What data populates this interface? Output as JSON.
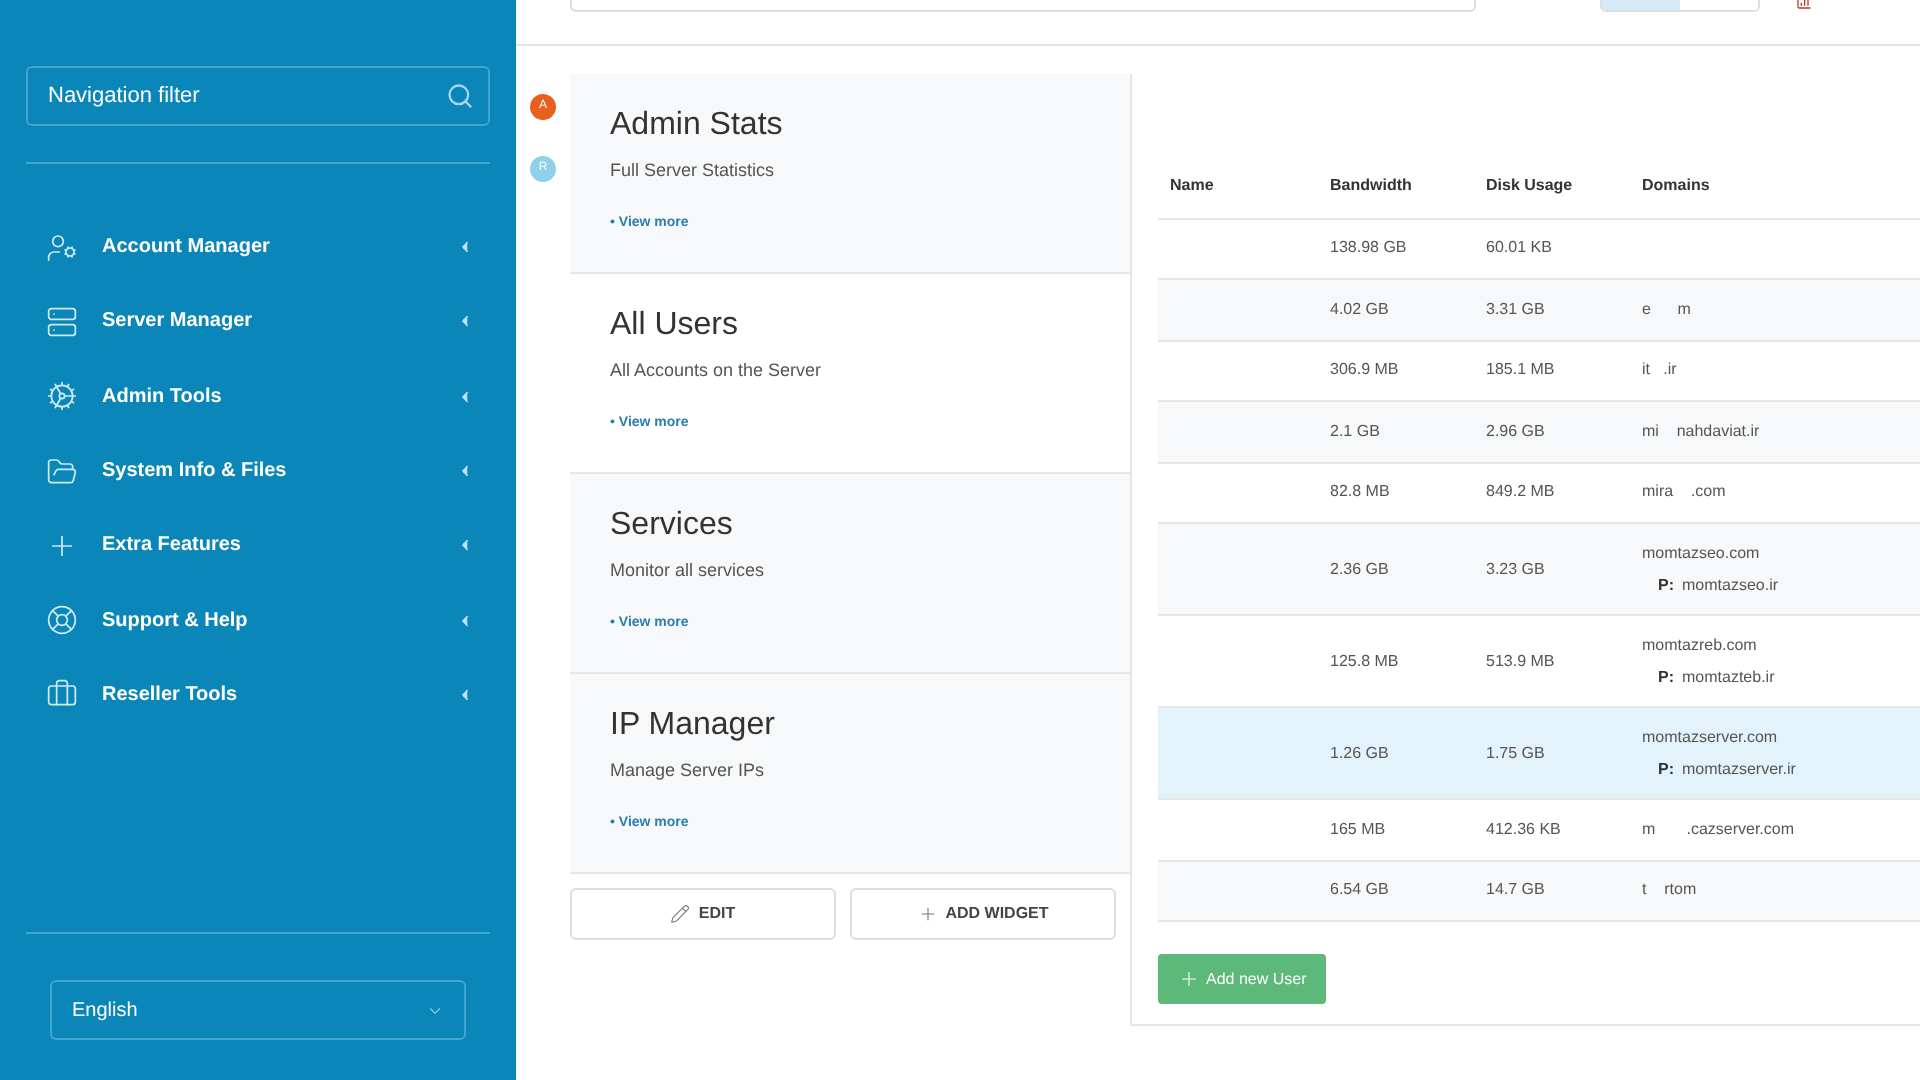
{
  "sidebar": {
    "filter": {
      "placeholder": "Navigation filter"
    },
    "items": [
      {
        "label": "Account Manager"
      },
      {
        "label": "Server Manager"
      },
      {
        "label": "Admin Tools"
      },
      {
        "label": "System Info & Files"
      },
      {
        "label": "Extra Features"
      },
      {
        "label": "Support & Help"
      },
      {
        "label": "Reseller Tools"
      }
    ],
    "language": "English"
  },
  "top_toggle": [
    {
      "selected": true
    },
    {
      "selected": false
    }
  ],
  "badges": [
    {
      "label": "A",
      "color": "#e8601c"
    },
    {
      "label": "R",
      "color": "#8fd0ea"
    }
  ],
  "widgets": [
    {
      "title": "Admin Stats",
      "subtitle": "Full Server Statistics",
      "link": "• View more"
    },
    {
      "title": "All Users",
      "subtitle": "All Accounts on the Server",
      "link": "• View more"
    },
    {
      "title": "Services",
      "subtitle": "Monitor all services",
      "link": "• View more"
    },
    {
      "title": "IP Manager",
      "subtitle": "Manage Server IPs",
      "link": "• View more"
    }
  ],
  "widget_buttons": [
    {
      "label": "EDIT"
    },
    {
      "label": "ADD WIDGET"
    }
  ],
  "table": {
    "columns": [
      "Name",
      "Bandwidth",
      "Disk Usage",
      "Domains"
    ],
    "rows": [
      {
        "bandwidth": "138.98 GB",
        "disk": "60.01 KB",
        "selected": false
      },
      {
        "bandwidth": "4.02 GB",
        "disk": "3.31 GB",
        "domain": "e      m",
        "selected": false
      },
      {
        "bandwidth": "306.9 MB",
        "disk": "185.1 MB",
        "domain": "it   .ir",
        "selected": false
      },
      {
        "bandwidth": "2.1 GB",
        "disk": "2.96 GB",
        "domain": "mi    nahdaviat.ir",
        "selected": false
      },
      {
        "bandwidth": "82.8 MB",
        "disk": "849.2 MB",
        "domain": "mira    .com",
        "selected": false
      },
      {
        "bandwidth": "2.36 GB",
        "disk": "3.23 GB",
        "domain": "momtazseo.com",
        "parked_label": "P:",
        "parked": "momtazseo.ir",
        "selected": false
      },
      {
        "bandwidth": "125.8 MB",
        "disk": "513.9 MB",
        "domain": "momtazreb.com",
        "parked_label": "P:",
        "parked": "momtazteb.ir",
        "selected": false
      },
      {
        "bandwidth": "1.26 GB",
        "disk": "1.75 GB",
        "domain": "momtazserver.com",
        "parked_label": "P:",
        "parked": "momtazserver.ir",
        "selected": true
      },
      {
        "bandwidth": "165 MB",
        "disk": "412.36 KB",
        "domain": "m       .cazserver.com",
        "selected": false
      },
      {
        "bandwidth": "6.54 GB",
        "disk": "14.7 GB",
        "domain": "t    rtom",
        "selected": false
      }
    ]
  },
  "add_button": "Add new User"
}
